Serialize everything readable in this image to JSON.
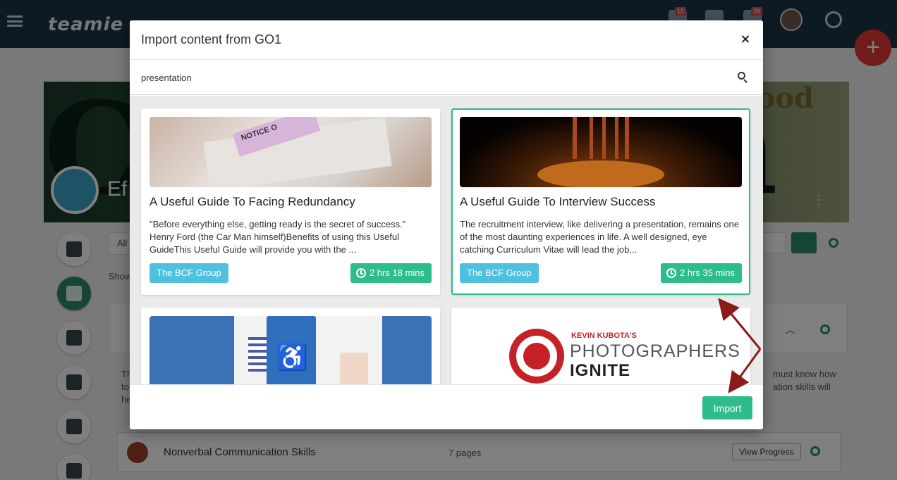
{
  "background": {
    "logo": "teamie",
    "notifications_badge": "15",
    "messages_badge": "28",
    "hero_good": "Good",
    "hero_letters": "Co",
    "hero_letters_right": "n",
    "hero_title_partial": "Ef",
    "filter_partial": "All",
    "show_partial": "Show",
    "description_partial_1": "must know how",
    "description_partial_2": "ation skills will",
    "left_partial_1": "Th",
    "left_partial_2": "to",
    "left_partial_3": "he",
    "row": {
      "title": "Nonverbal Communication Skills",
      "pages": "7 pages",
      "action": "View Progress"
    }
  },
  "modal": {
    "title": "Import content from GO1",
    "search": {
      "value": "presentation"
    },
    "cards": [
      {
        "title": "A Useful Guide To Facing Redundancy",
        "description": "\"Before everything else, getting ready is the secret of success.\" Henry Ford (the Car Man himself)Benefits of using this Useful GuideThis Useful Guide will provide you with the ...",
        "provider": "The BCF Group",
        "duration": "2 hrs 18 mins",
        "image_text": "NOTICE O"
      },
      {
        "title": "A Useful Guide To Interview Success",
        "description": "The recruitment interview, like delivering a presentation, remains one of the most daunting experiences in life. A well designed, eye catching Curriculum Vitae will lead the job...",
        "provider": "The BCF Group",
        "duration": "2 hrs 35 mins",
        "selected": true
      },
      {
        "title": "",
        "image": "accessibility-document"
      },
      {
        "title": "",
        "image": "photographers-ignite-logo",
        "logo_line1": "KEVIN KUBOTA'S",
        "logo_line2": "PHOTOGRAPHERS",
        "logo_line3": "IGNITE"
      }
    ],
    "import_label": "Import"
  },
  "colors": {
    "accent": "#2ebc8b",
    "provider": "#4fc0dd",
    "annotation_arrow": "#8b1a1a",
    "topbar": "#1d3447"
  }
}
